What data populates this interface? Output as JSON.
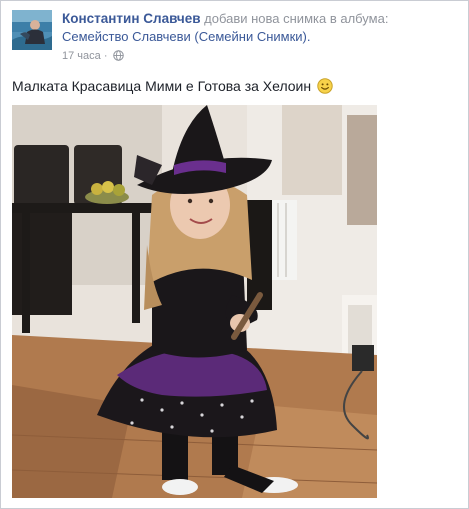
{
  "post": {
    "author": "Константин Славчев",
    "action": "добави нова снимка в албума:",
    "album": "Семейство Славчеви (Семейни Снимки).",
    "time": "17 часа",
    "dot": "·",
    "privacy_icon": "globe-icon",
    "caption": "Малката Красавица Мими е Готова за Хелоин",
    "caption_emoji": "smiley-icon"
  },
  "colors": {
    "link": "#3b5998",
    "muted": "#90949c",
    "text": "#1d2129",
    "border": "#c9ccd3"
  }
}
